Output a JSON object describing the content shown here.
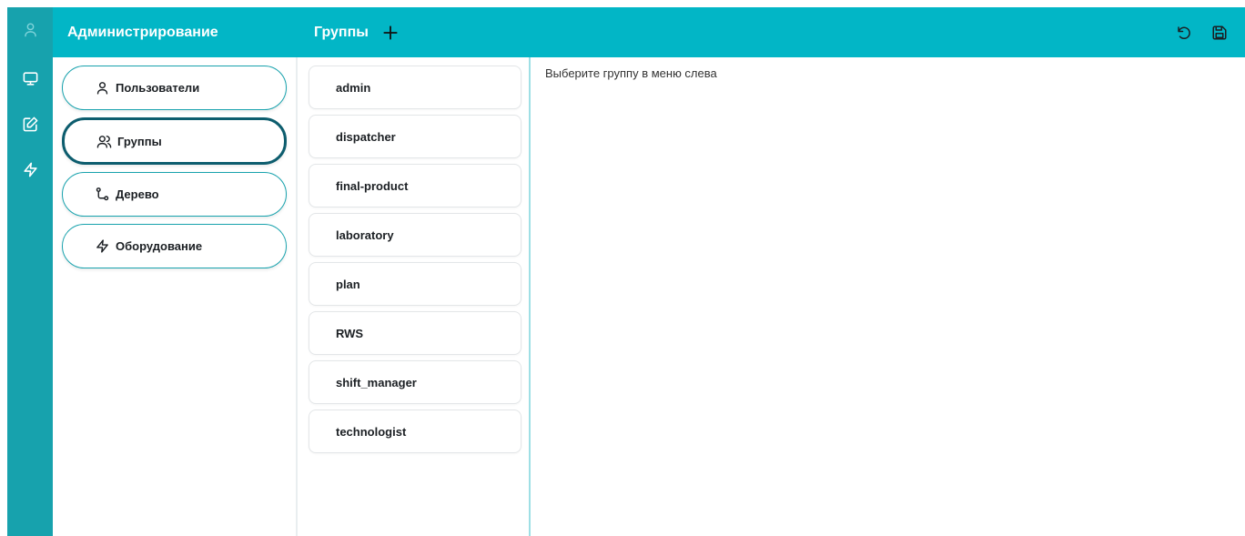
{
  "colors": {
    "rail": "#17a2ad",
    "topbar": "#02b6c6",
    "active_border": "#0d5d6e",
    "accent_border": "#17a2ad"
  },
  "rail": {
    "items": [
      {
        "icon": "user-icon"
      },
      {
        "icon": "monitor-icon"
      },
      {
        "icon": "edit-icon"
      },
      {
        "icon": "lightning-icon"
      }
    ]
  },
  "admin": {
    "title": "Администрирование",
    "nav": [
      {
        "label": "Пользователи",
        "icon": "user-icon"
      },
      {
        "label": "Группы",
        "icon": "users-icon",
        "active": true
      },
      {
        "label": "Дерево",
        "icon": "tree-icon"
      },
      {
        "label": "Оборудование",
        "icon": "lightning-icon"
      }
    ]
  },
  "groups": {
    "title": "Группы",
    "add_icon": "plus-icon",
    "items": [
      "admin",
      "dispatcher",
      "final-product",
      "laboratory",
      "plan",
      "RWS",
      "shift_manager",
      "technologist"
    ]
  },
  "toolbar": {
    "actions": [
      {
        "icon": "undo-icon"
      },
      {
        "icon": "save-icon"
      }
    ]
  },
  "content": {
    "hint": "Выберите группу в меню слева"
  }
}
